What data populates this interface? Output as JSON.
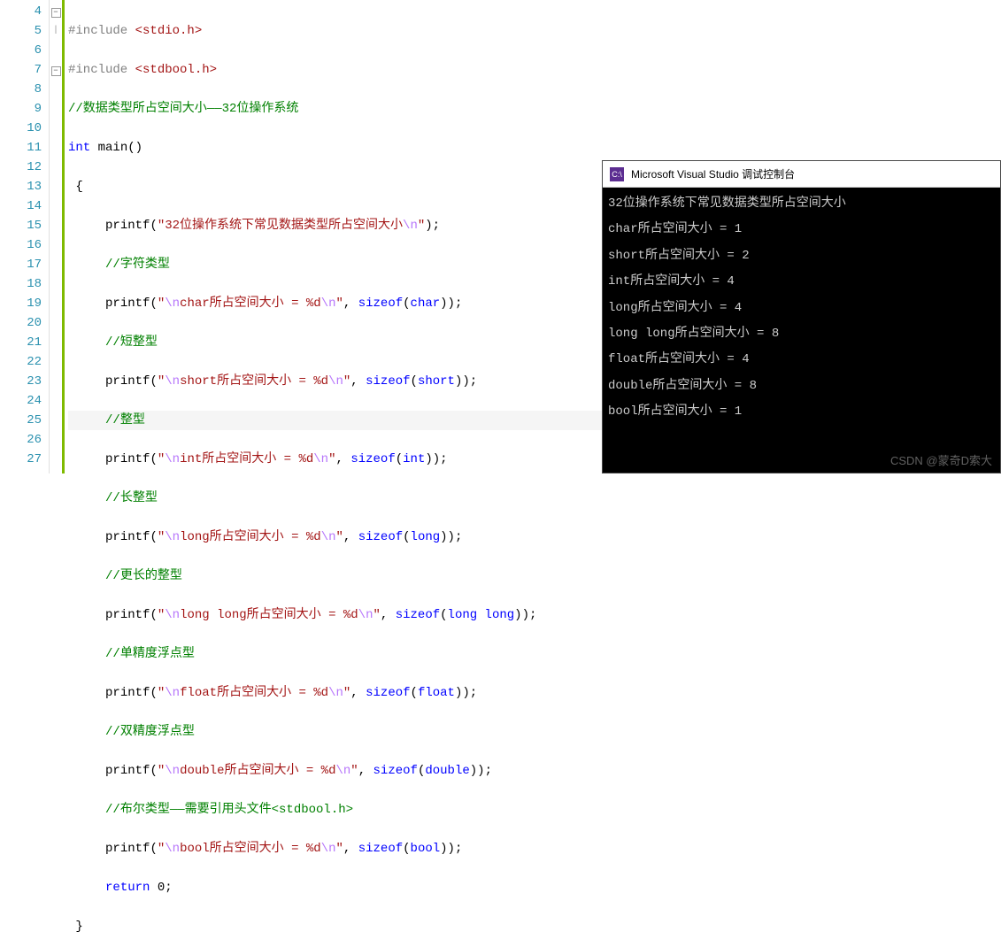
{
  "editor": {
    "lines": {
      "start": 4,
      "end": 27
    },
    "fold_minus": "−",
    "bar_line4": "|",
    "comments": {
      "c6": "//数据类型所占空间大小——32位操作系统",
      "c10": "//字符类型",
      "c12": "//短整型",
      "c14": "//整型",
      "c16": "//长整型",
      "c18": "//更长的整型",
      "c20": "//单精度浮点型",
      "c22": "//双精度浮点型",
      "c24": "//布尔类型——需要引用头文件<stdbool.h>"
    },
    "pp_include": "#include",
    "inc1": " <stdio.h>",
    "inc2": " <stdbool.h>",
    "int_kw": "int",
    "main_id": " main()",
    "brace_open": "{",
    "brace_close": "}",
    "printf": "printf",
    "sizeof": "sizeof",
    "return_kw": "return",
    "zero": " 0",
    "semi": ";",
    "comma": ", ",
    "str9a": "\"32位操作系统下常见数据类型所占空间大小",
    "str9b": "\"",
    "esc_n": "\\n",
    "str11a": "\"",
    "str11b": "char所占空间大小 = %d",
    "str11c": "\"",
    "str13b": "short所占空间大小 = %d",
    "str15b": "int所占空间大小 = %d",
    "str17b": "long所占空间大小 = %d",
    "str19b": "long long所占空间大小 = %d",
    "str21b": "float所占空间大小 = %d",
    "str23b": "double所占空间大小 = %d",
    "str25b": "bool所占空间大小 = %d",
    "type_char": "char",
    "type_short": "short",
    "type_int": "int",
    "type_long": "long",
    "type_longlong": "long long",
    "type_float": "float",
    "type_double": "double",
    "type_bool": "bool"
  },
  "console": {
    "title": "Microsoft Visual Studio 调试控制台",
    "icon_text": "C:\\",
    "lines": [
      "32位操作系统下常见数据类型所占空间大小",
      "char所占空间大小 = 1",
      "short所占空间大小 = 2",
      "int所占空间大小 = 4",
      "long所占空间大小 = 4",
      "long long所占空间大小 = 8",
      "float所占空间大小 = 4",
      "double所占空间大小 = 8",
      "bool所占空间大小 = 1"
    ]
  },
  "watermark": "CSDN @蒙奇D索大"
}
